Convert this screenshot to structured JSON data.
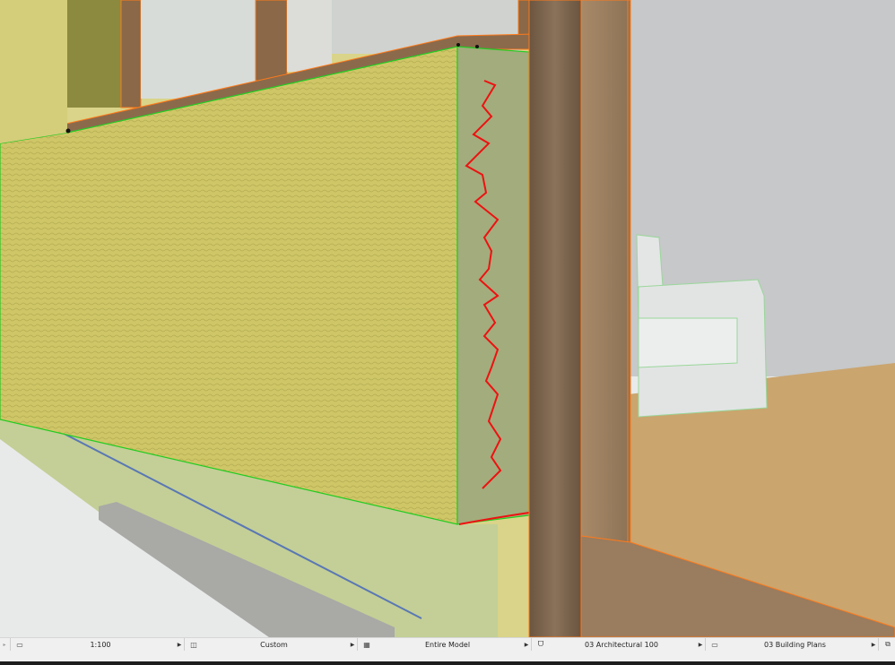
{
  "statusbar": {
    "scale": {
      "icon": "ruler-icon",
      "value": "1:100"
    },
    "layer_combination": {
      "icon": "layers-icon",
      "value": "Custom"
    },
    "model_view": {
      "icon": "model-view-icon",
      "value": "Entire Model"
    },
    "pen_set": {
      "icon": "pen-icon",
      "value": "03 Architectural 100"
    },
    "view_map": {
      "icon": "plan-icon",
      "value": "03 Building Plans"
    },
    "copy_icon": "copy-icon"
  },
  "colors": {
    "selection_outline": "#ff7a1a",
    "edit_outline": "#22cc22",
    "markup_red": "#ee1111"
  }
}
